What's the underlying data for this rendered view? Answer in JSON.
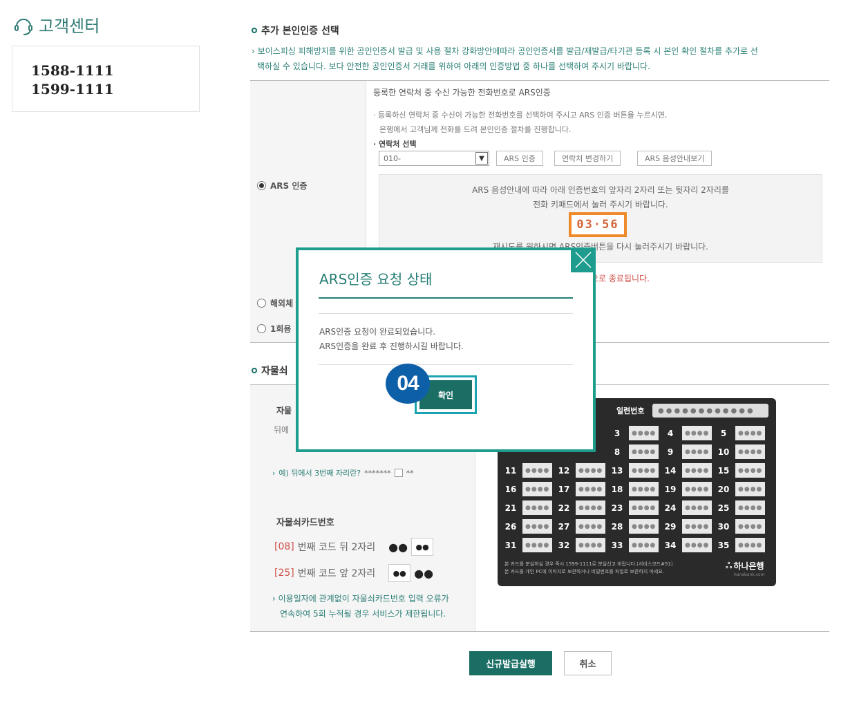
{
  "sidebar": {
    "title": "고객센터",
    "phones": [
      "1588-1111",
      "1599-1111"
    ]
  },
  "auth_section": {
    "title": "추가 본인인증 선택",
    "notice_line1": "보이스피싱 피해방지를 위한 공인인증서 발급 및 사용 절차 강화방안에따라 공인인증서를 발급/재발급/타기관 등록 시 본인 확인 절차를 추가로 선",
    "notice_line2": "택하실 수 있습니다. 보다 안전한 공인인증서 거래를 위하여 아래의 인증방법 중 하나를 선택하여 주시기 바랍니다.",
    "options": {
      "ars_label": "ARS 인증",
      "overseas_label": "해외체",
      "otp_label": "1회용"
    },
    "ars": {
      "heading": "등록한 연락처 중 수신 가능한 전화번호로 ARS인증",
      "desc1": "등록하신 연락처 중 수신이 가능한 전화번호를 선택하여 주시고 ARS 인증 버튼을 누르시면,",
      "desc2": "은행에서 고객님께 전화를 드려 본인인증 절차를 진행합니다.",
      "contact_label": "연락처 선택",
      "select_value": "010-",
      "btn_ars": "ARS 인증",
      "btn_change": "연락처 변경하기",
      "btn_guide": "ARS 음성안내보기",
      "guide1": "ARS 음성안내에 따라 아래 인증번호의 앞자리 2자리 또는 뒷자리 2자리를",
      "guide2": "전화 키패드에서 눌러 주시기 바랍니다.",
      "timer": "03·56",
      "retry": "재시도를 원하시면 ARS인증버튼을 다시 눌러주시기 바랍니다.",
      "expire": "으로 종료됩니다."
    }
  },
  "card_section": {
    "title": "자물쇠",
    "left_label1": "자물",
    "left_label2": "뒤에",
    "example": "예) 뒤에서 3번째 자리란?",
    "example_mask": "*******",
    "example_tail": "**",
    "card_number_label": "자물쇠카드번호",
    "row1_prefix": "[08]",
    "row1_text": "번째 코드 뒤 2자리",
    "row2_prefix": "[25]",
    "row2_text": "번째 코드 앞 2자리",
    "warn1": "이용일자에 관계없이 자물쇠카드번호 입력 오류가",
    "warn2": "연속하여 5회 누적될 경우 서비스가 제한됩니다.",
    "card": {
      "serial_label": "일련번호",
      "numbers": [
        3,
        4,
        5,
        8,
        9,
        10,
        11,
        12,
        13,
        14,
        15,
        16,
        17,
        18,
        19,
        20,
        21,
        22,
        23,
        24,
        25,
        26,
        27,
        28,
        29,
        30,
        31,
        32,
        33,
        34,
        35
      ],
      "dots": "●●●●",
      "note1": "본 카드를 분실하실 경우 즉시 1599-1111로 분실신고 바랍니다.(서비스코드#51)",
      "note2": "본 카드를 개인 PC에 이미지로 보관하거나 비밀번호를 파일로 보관하지 마세요.",
      "brand": "하나은행",
      "brand_url": "hanabank.com"
    }
  },
  "buttons": {
    "issue": "신규발급실행",
    "cancel": "취소"
  },
  "modal": {
    "title": "ARS인증 요청 상태",
    "msg1": "ARS인증 요청이 완료되었습니다.",
    "msg2": "ARS인증을 완료 후 진행하시길 바랍니다.",
    "ok": "확인",
    "close_icon": "close-icon"
  },
  "step_badge": "04",
  "colors": {
    "brand_green": "#1b6e64",
    "modal_teal": "#1e9c8d",
    "badge_blue": "#0d5fa8",
    "timer_orange": "#ef8a2a"
  }
}
